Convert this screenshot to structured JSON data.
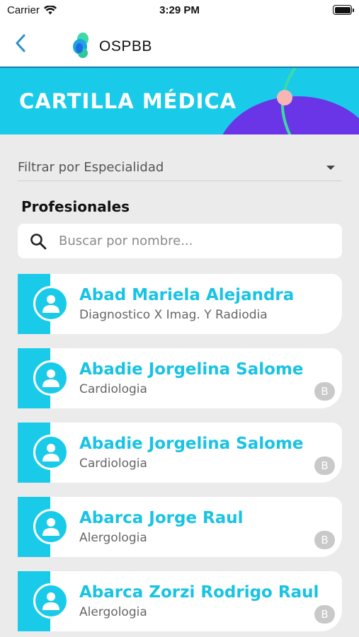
{
  "status_bar": {
    "carrier": "Carrier",
    "time": "3:29 PM"
  },
  "nav": {
    "title": "OSPBB",
    "back_icon": "chevron-left-icon"
  },
  "banner": {
    "title": "CARTILLA MÉDICA"
  },
  "filter": {
    "label": "Filtrar por Especialidad"
  },
  "section": {
    "title": "Profesionales"
  },
  "search": {
    "placeholder": "Buscar por nombre..."
  },
  "colors": {
    "accent": "#19cbe9",
    "name_text": "#19c3e4",
    "banner_circle": "#6a35e6",
    "banner_dot": "#f7b6b6",
    "banner_line": "#3ed9a4",
    "badge": "#c9c9c9"
  },
  "professionals": [
    {
      "name": "Abad Mariela Alejandra",
      "specialty": "Diagnostico X Imag. Y Radiodia",
      "badge": ""
    },
    {
      "name": "Abadie Jorgelina Salome",
      "specialty": "Cardiologia",
      "badge": "B"
    },
    {
      "name": "Abadie Jorgelina Salome",
      "specialty": "Cardiologia",
      "badge": "B"
    },
    {
      "name": "Abarca Jorge Raul",
      "specialty": "Alergologia",
      "badge": "B"
    },
    {
      "name": "Abarca Zorzi Rodrigo Raul",
      "specialty": "Alergologia",
      "badge": "B"
    }
  ]
}
